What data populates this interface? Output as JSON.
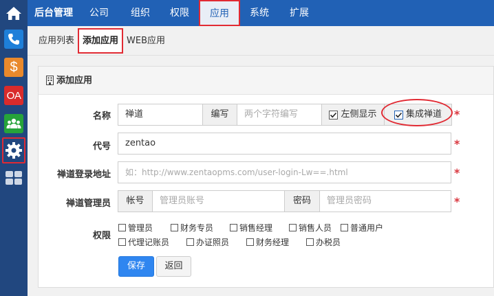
{
  "sidebar": {
    "items": [
      {
        "name": "home",
        "icon": "home-icon"
      },
      {
        "name": "phone",
        "icon": "phone-icon",
        "color": "#1e7fd9"
      },
      {
        "name": "money",
        "icon": "dollar-icon",
        "color": "#e9892c",
        "text": "$"
      },
      {
        "name": "oa",
        "icon": "oa-icon",
        "color": "#d92b2b",
        "text": "OA"
      },
      {
        "name": "people",
        "icon": "people-icon",
        "color": "#26a33a"
      },
      {
        "name": "settings",
        "icon": "gear-icon",
        "active": true
      },
      {
        "name": "apps",
        "icon": "grid-icon"
      }
    ]
  },
  "topnav": {
    "brand": "后台管理",
    "items": [
      "公司",
      "组织",
      "权限",
      "应用",
      "系统",
      "扩展"
    ],
    "active": "应用"
  },
  "subnav": {
    "items": [
      "应用列表",
      "添加应用",
      "WEB应用"
    ],
    "active": "添加应用"
  },
  "panel": {
    "title": "添加应用"
  },
  "form": {
    "name_label": "名称",
    "name_value": "禅道",
    "abbr_label": "编写",
    "abbr_placeholder": "两个字符编写",
    "left_display_label": "左侧显示",
    "left_display_checked": true,
    "integrate_label": "集成禅道",
    "integrate_checked": true,
    "code_label": "代号",
    "code_value": "zentao",
    "login_url_label": "禅道登录地址",
    "login_url_placeholder": "如：http://www.zentaopms.com/user-login-Lw==.html",
    "admin_label": "禅道管理员",
    "account_label": "帐号",
    "account_placeholder": "管理员账号",
    "password_label": "密码",
    "password_placeholder": "管理员密码",
    "permission_label": "权限",
    "permissions_row1": [
      "管理员",
      "财务专员",
      "销售经理",
      "销售人员",
      "普通用户"
    ],
    "permissions_row2": [
      "代理记账员",
      "办证照员",
      "财务经理",
      "办税员"
    ],
    "save_label": "保存",
    "back_label": "返回",
    "required_mark": "*"
  },
  "colors": {
    "topnav": "#2161b5",
    "sidebar": "#21477f",
    "highlight": "#e12a33",
    "primary_button": "#2f86f0",
    "required": "#d9363e"
  }
}
